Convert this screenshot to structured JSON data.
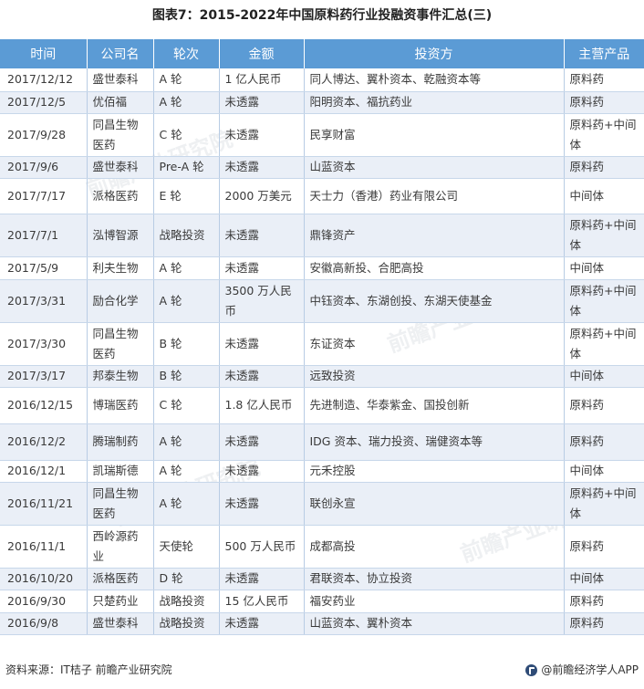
{
  "title": "图表7：2015-2022年中国原料药行业投融资事件汇总(三)",
  "headers": [
    "时间",
    "公司名",
    "轮次",
    "金额",
    "投资方",
    "主营产品"
  ],
  "rows": [
    {
      "date": "2017/12/12",
      "company": "盛世泰科",
      "round": "A 轮",
      "amount": "1 亿人民币",
      "investors": "同人博达、翼朴资本、乾融资本等",
      "product": "原料药"
    },
    {
      "date": "2017/12/5",
      "company": "优佰福",
      "round": "A 轮",
      "amount": "未透露",
      "investors": "阳明资本、福抗药业",
      "product": "原料药"
    },
    {
      "date": "2017/9/28",
      "company": "同昌生物医药",
      "round": "C 轮",
      "amount": "未透露",
      "investors": "民享财富",
      "product": "原料药+中间体"
    },
    {
      "date": "2017/9/6",
      "company": "盛世泰科",
      "round": "Pre-A 轮",
      "amount": "未透露",
      "investors": "山蓝资本",
      "product": "原料药"
    },
    {
      "date": "2017/7/17",
      "company": "派格医药",
      "round": "E 轮",
      "amount": "2000 万美元",
      "investors": "天士力（香港）药业有限公司",
      "product": "中间体"
    },
    {
      "date": "2017/7/1",
      "company": "泓博智源",
      "round": "战略投资",
      "amount": "未透露",
      "investors": "鼎锋资产",
      "product": "原料药+中间体"
    },
    {
      "date": "2017/5/9",
      "company": "利夫生物",
      "round": "A 轮",
      "amount": "未透露",
      "investors": "安徽高新投、合肥高投",
      "product": "中间体"
    },
    {
      "date": "2017/3/31",
      "company": "励合化学",
      "round": "A 轮",
      "amount": "3500 万人民币",
      "investors": "中钰资本、东湖创投、东湖天使基金",
      "product": "原料药+中间体"
    },
    {
      "date": "2017/3/30",
      "company": "同昌生物医药",
      "round": "B 轮",
      "amount": "未透露",
      "investors": "东证资本",
      "product": "原料药+中间体"
    },
    {
      "date": "2017/3/17",
      "company": "邦泰生物",
      "round": "B 轮",
      "amount": "未透露",
      "investors": "远致投资",
      "product": "中间体"
    },
    {
      "date": "2016/12/15",
      "company": "博瑞医药",
      "round": "C 轮",
      "amount": "1.8 亿人民币",
      "investors": "先进制造、华泰紫金、国投创新",
      "product": "原料药"
    },
    {
      "date": "2016/12/2",
      "company": "腾瑞制药",
      "round": "A 轮",
      "amount": "未透露",
      "investors": "IDG 资本、瑞力投资、瑞健资本等",
      "product": "原料药"
    },
    {
      "date": "2016/12/1",
      "company": "凯瑞斯德",
      "round": "A 轮",
      "amount": "未透露",
      "investors": "元禾控股",
      "product": "中间体"
    },
    {
      "date": "2016/11/21",
      "company": "同昌生物医药",
      "round": "A 轮",
      "amount": "未透露",
      "investors": "联创永宣",
      "product": "原料药+中间体"
    },
    {
      "date": "2016/11/1",
      "company": "西岭源药业",
      "round": "天使轮",
      "amount": "500 万人民币",
      "investors": "成都高投",
      "product": "原料药"
    },
    {
      "date": "2016/10/20",
      "company": "派格医药",
      "round": "D 轮",
      "amount": "未透露",
      "investors": "君联资本、协立投资",
      "product": "中间体"
    },
    {
      "date": "2016/9/30",
      "company": "只楚药业",
      "round": "战略投资",
      "amount": "15 亿人民币",
      "investors": "福安药业",
      "product": "原料药"
    },
    {
      "date": "2016/9/8",
      "company": "盛世泰科",
      "round": "战略投资",
      "amount": "未透露",
      "investors": "山蓝资本、翼朴资本",
      "product": "原料药"
    }
  ],
  "footer": {
    "source": "资料来源：IT桔子 前瞻产业研究院",
    "brand": "@前瞻经济学人APP"
  },
  "watermark": "前瞻产业研究院",
  "colors": {
    "header": "#5b9bd5",
    "row_alt": "#eaeff7"
  }
}
